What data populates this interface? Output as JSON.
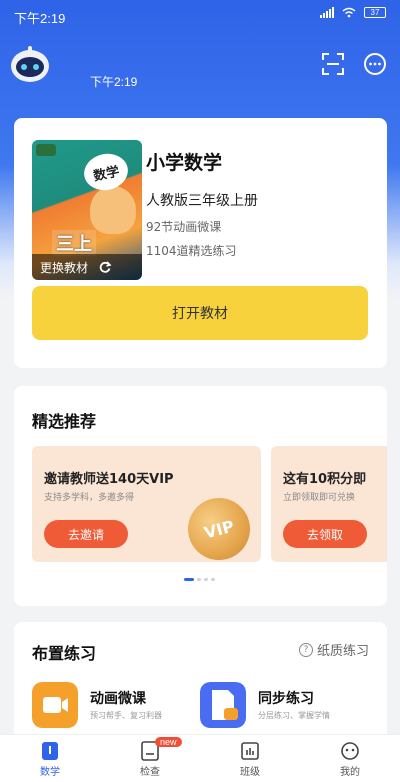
{
  "status_bar": {
    "time": "下午2:19",
    "battery": "37"
  },
  "header": {
    "time": "下午2:19"
  },
  "book": {
    "cover_badge": "数学",
    "cover_grade": "三上",
    "change_label": "更换教材",
    "title": "小学数学",
    "edition": "人教版三年级上册",
    "lessons": "92节动画微课",
    "exercises": "1104道精选练习",
    "open_button": "打开教材"
  },
  "recommend": {
    "title": "精选推荐",
    "items": [
      {
        "heading": "邀请教师送140天VIP",
        "sub": "支持多学科，多邀多得",
        "button": "去邀请",
        "badge": "VIP"
      },
      {
        "heading": "这有10积分即",
        "sub": "立即领取即可兑换",
        "button": "去领取"
      }
    ]
  },
  "practice": {
    "title": "布置练习",
    "paper_link": "纸质练习",
    "features": [
      {
        "title": "动画微课",
        "sub": "预习帮手、复习利器",
        "color": "#f5a02a"
      },
      {
        "title": "同步练习",
        "sub": "分层练习、掌握学情",
        "color": "#4a6cf0",
        "badge": "元"
      }
    ]
  },
  "tabs": [
    {
      "label": "数学",
      "icon": "home-icon",
      "active": true
    },
    {
      "label": "检查",
      "icon": "check-icon",
      "badge": "new"
    },
    {
      "label": "班级",
      "icon": "class-icon"
    },
    {
      "label": "我的",
      "icon": "profile-icon"
    }
  ],
  "colors": {
    "primary": "#2f63e8",
    "accent": "#f7d23c",
    "orange": "#ef5b36"
  }
}
